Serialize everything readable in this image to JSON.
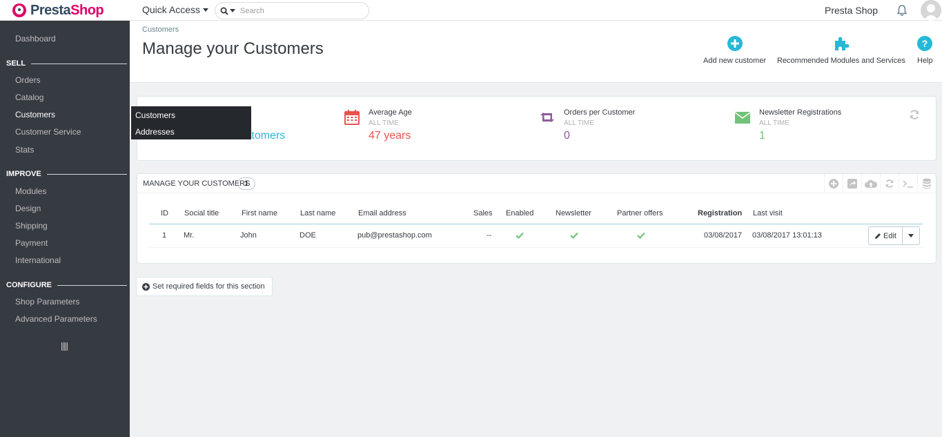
{
  "topbar": {
    "logo_text_a": "Presta",
    "logo_text_b": "Shop",
    "quick_access": "Quick Access",
    "search_placeholder": "Search",
    "shop_name": "Presta Shop"
  },
  "sidebar": {
    "dashboard": "Dashboard",
    "sections": {
      "sell": "SELL",
      "improve": "IMPROVE",
      "configure": "CONFIGURE"
    },
    "items": {
      "orders": "Orders",
      "catalog": "Catalog",
      "customers": "Customers",
      "customer_service": "Customer Service",
      "stats": "Stats",
      "modules": "Modules",
      "design": "Design",
      "shipping": "Shipping",
      "payment": "Payment",
      "international": "International",
      "shop_parameters": "Shop Parameters",
      "advanced_parameters": "Advanced Parameters"
    },
    "submenu": [
      "Customers",
      "Addresses"
    ]
  },
  "header": {
    "breadcrumb": "Customers",
    "title": "Manage your Customers",
    "toolbar": {
      "add": "Add new customer",
      "recommended": "Recommended Modules and Services",
      "help": "Help"
    }
  },
  "kpis": {
    "first_value": "100% male customers",
    "age": {
      "title": "Average Age",
      "sub": "ALL TIME",
      "value": "47 years"
    },
    "orders": {
      "title": "Orders per Customer",
      "sub": "ALL TIME",
      "value": "0"
    },
    "newsletter": {
      "title": "Newsletter Registrations",
      "sub": "ALL TIME",
      "value": "1"
    }
  },
  "colors": {
    "accent": "#25b9d7",
    "age": "#e9524d",
    "orders": "#8d5b9d",
    "newsletter": "#72c279",
    "sidebar": "#363a41"
  },
  "table": {
    "title": "MANAGE YOUR CUSTOMERS",
    "count": "1",
    "columns": {
      "id": "ID",
      "social": "Social title",
      "first": "First name",
      "last": "Last name",
      "email": "Email address",
      "sales": "Sales",
      "enabled": "Enabled",
      "newsletter": "Newsletter",
      "partner": "Partner offers",
      "registration": "Registration",
      "last_visit": "Last visit"
    },
    "row": {
      "id": "1",
      "social": "Mr.",
      "first": "John",
      "last": "DOE",
      "email": "pub@prestashop.com",
      "sales": "--",
      "registration": "03/08/2017",
      "last_visit": "03/08/2017 13:01:13",
      "edit": "Edit"
    }
  },
  "required_fields_button": "Set required fields for this section"
}
